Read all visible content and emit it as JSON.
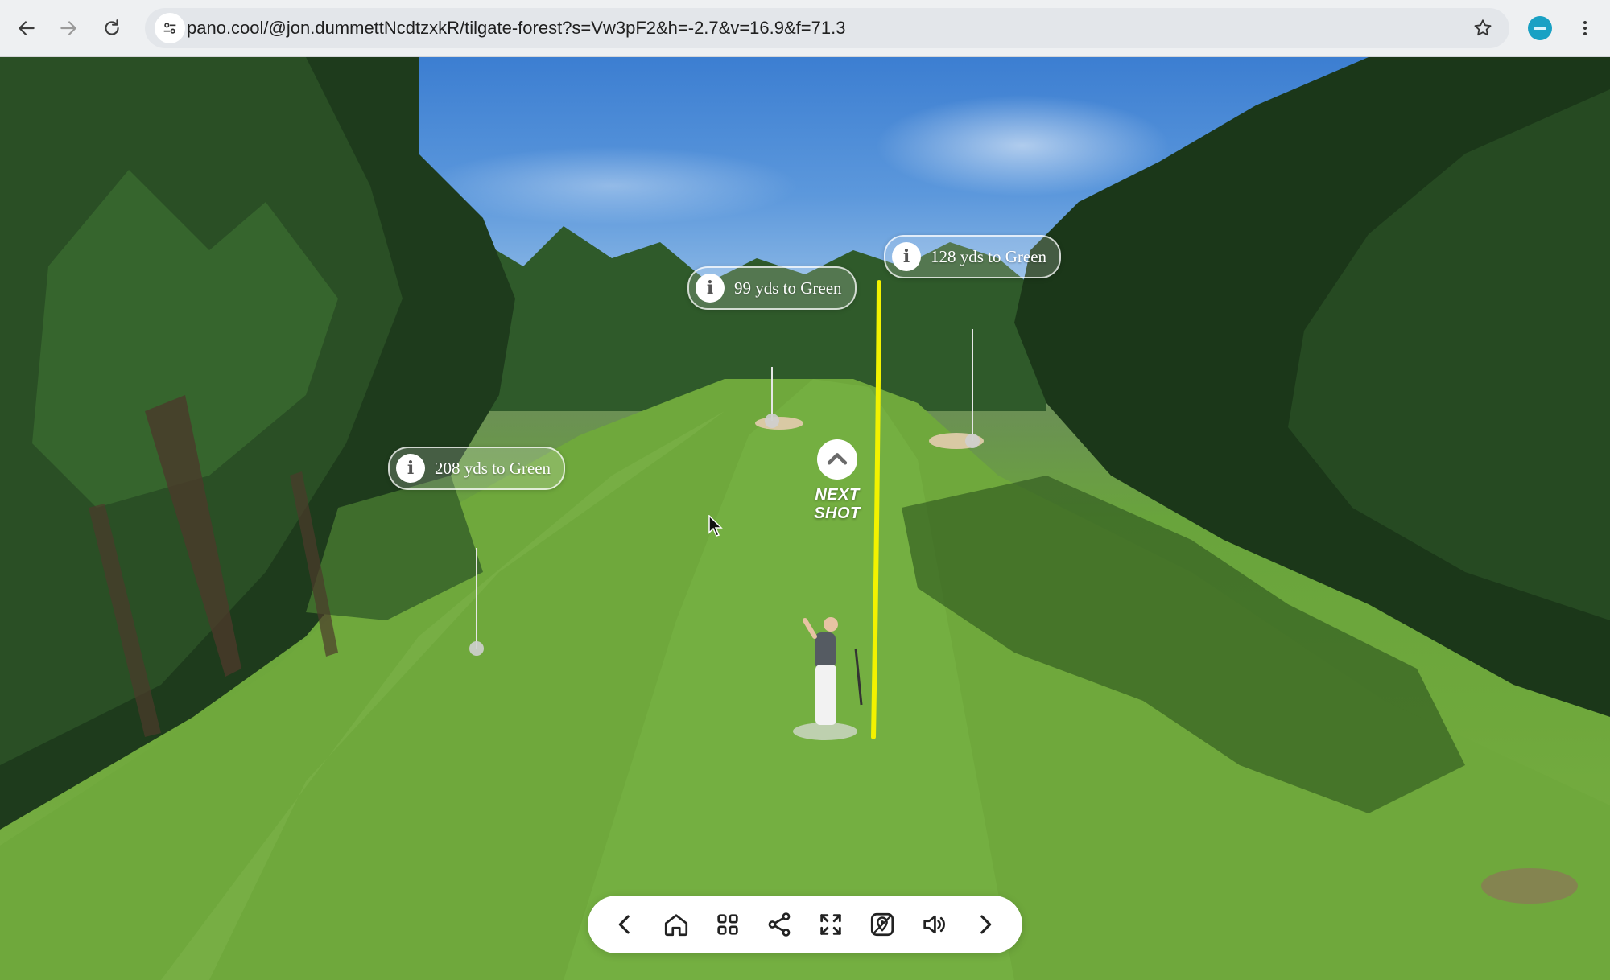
{
  "browser": {
    "url": "pano.cool/@jon.dummettNcdtzxkR/tilgate-forest?s=Vw3pF2&h=-2.7&v=16.9&f=71.3",
    "icons": [
      "back-arrow-icon",
      "forward-arrow-icon",
      "reload-icon",
      "site-settings-icon",
      "bookmark-star-icon",
      "profile-avatar-icon",
      "more-options-icon"
    ]
  },
  "hotspots": [
    {
      "label": "99 yds to Green"
    },
    {
      "label": "128 yds to Green"
    },
    {
      "label": "208 yds to Green"
    }
  ],
  "next_shot": {
    "label": "NEXT SHOT"
  },
  "toolbar": {
    "icons": [
      "chevron-left-icon",
      "home-icon",
      "grid-icon",
      "share-icon",
      "fullscreen-icon",
      "map-pin-icon",
      "sound-icon",
      "chevron-right-icon"
    ]
  },
  "colors": {
    "tracer": "#f2f200",
    "chrome_bg": "#eef0f2",
    "fairway": "#6fa83c"
  }
}
